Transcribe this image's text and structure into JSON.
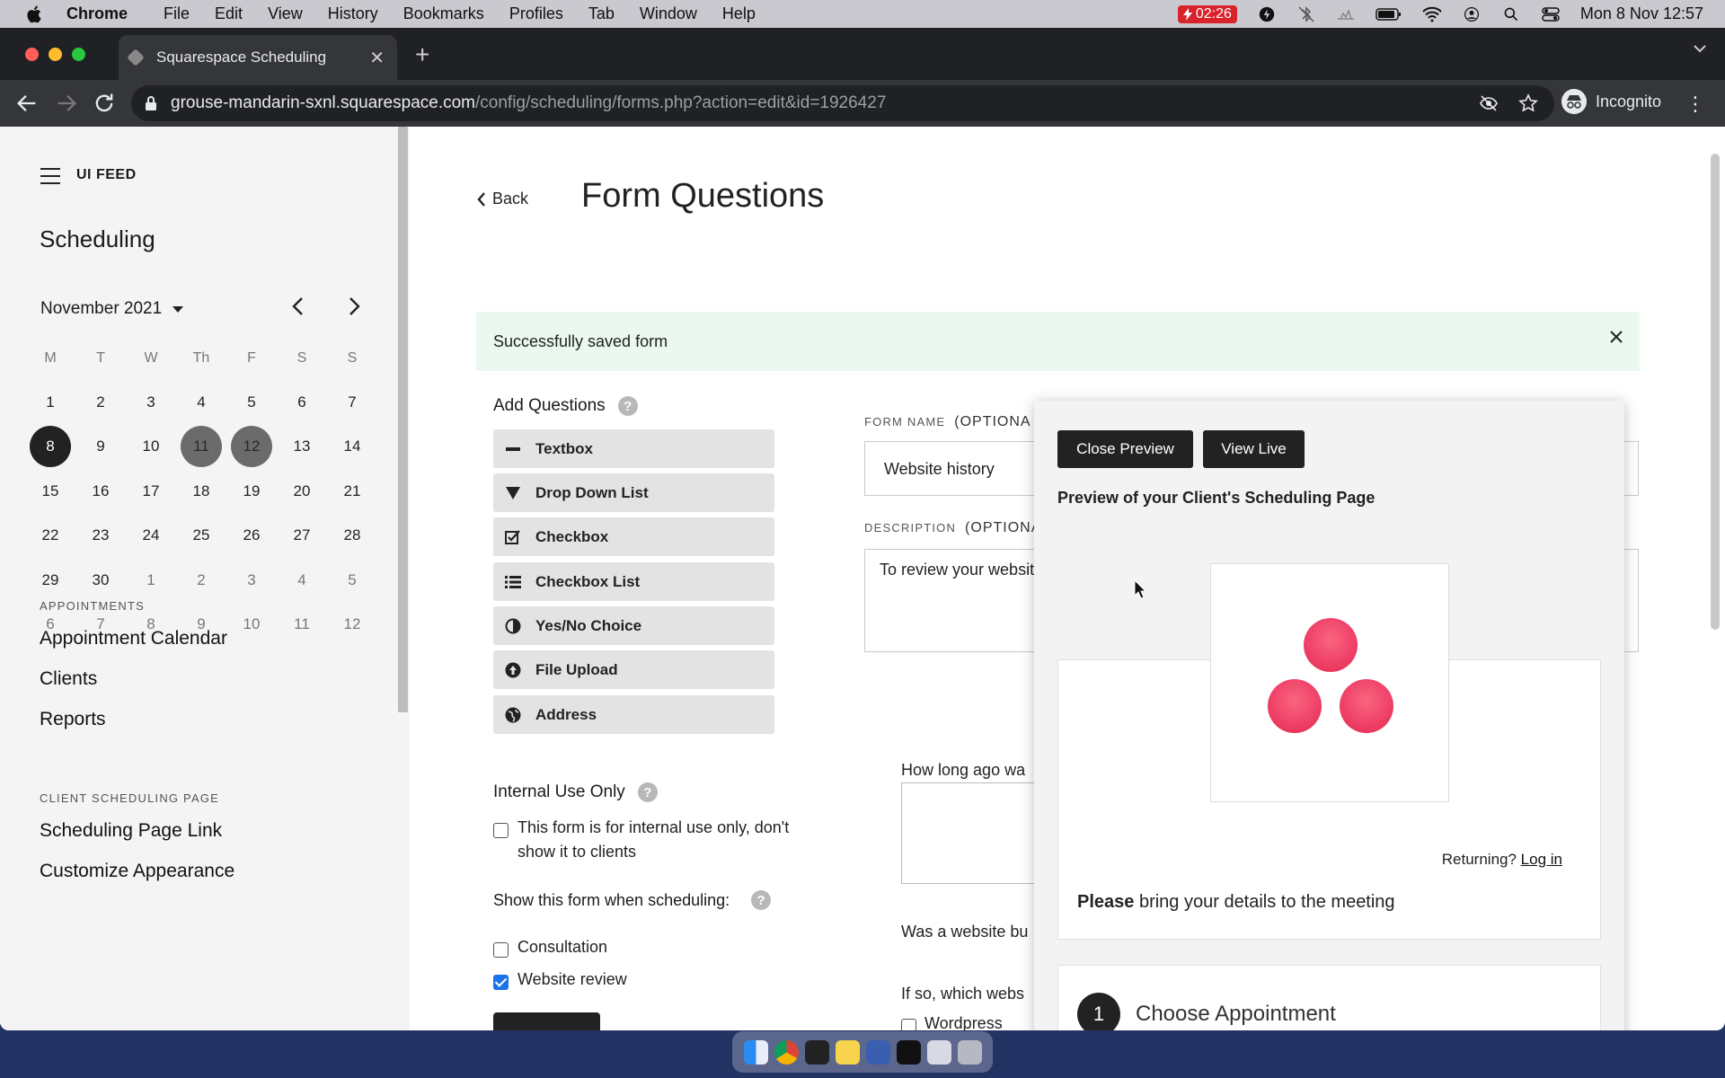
{
  "menubar": {
    "app": "Chrome",
    "items": [
      "File",
      "Edit",
      "View",
      "History",
      "Bookmarks",
      "Profiles",
      "Tab",
      "Window",
      "Help"
    ],
    "battery_time": "02:26",
    "datetime": "Mon 8 Nov  12:57"
  },
  "browser": {
    "tab_title": "Squarespace Scheduling",
    "url_host": "grouse-mandarin-sxnl.squarespace.com",
    "url_path": "/config/scheduling/forms.php?action=edit&id=1926427",
    "profile": "Incognito"
  },
  "sidebar": {
    "brand": "UI FEED",
    "title": "Scheduling",
    "month": "November 2021",
    "weekdays": [
      "M",
      "T",
      "W",
      "Th",
      "F",
      "S",
      "S"
    ],
    "weeks": [
      [
        "1",
        "2",
        "3",
        "4",
        "5",
        "6",
        "7"
      ],
      [
        "8",
        "9",
        "10",
        "11",
        "12",
        "13",
        "14"
      ],
      [
        "15",
        "16",
        "17",
        "18",
        "19",
        "20",
        "21"
      ],
      [
        "22",
        "23",
        "24",
        "25",
        "26",
        "27",
        "28"
      ],
      [
        "29",
        "30",
        "1",
        "2",
        "3",
        "4",
        "5"
      ],
      [
        "6",
        "7",
        "8",
        "9",
        "10",
        "11",
        "12"
      ]
    ],
    "appointments_label": "APPOINTMENTS",
    "appointments_links": [
      "Appointment Calendar",
      "Clients",
      "Reports"
    ],
    "client_label": "CLIENT SCHEDULING PAGE",
    "client_links": [
      "Scheduling Page Link",
      "Customize Appearance"
    ]
  },
  "main": {
    "back": "Back",
    "title": "Form Questions",
    "toast": "Successfully saved form",
    "add_questions": "Add Questions",
    "question_types": [
      "Textbox",
      "Drop Down List",
      "Checkbox",
      "Checkbox List",
      "Yes/No Choice",
      "File Upload",
      "Address"
    ],
    "form_name_label": "FORM NAME",
    "form_name_opt": "(OPTIONA",
    "form_name_value": "Website history",
    "description_label": "DESCRIPTION",
    "description_opt": "(OPTIONA",
    "description_value": "To review your websit",
    "internal_label": "Internal Use Only",
    "internal_checkbox_line1": "This form is for internal use only, don't",
    "internal_checkbox_line2": "show it to clients",
    "show_when": "Show this form when scheduling:",
    "appointment_types": [
      "Consultation",
      "Website review"
    ],
    "q1": "How long ago wa",
    "q2": "Was a website bu",
    "q3": "If so, which webs",
    "q3_option1": "Wordpress"
  },
  "preview": {
    "close_btn": "Close Preview",
    "view_live_btn": "View Live",
    "heading": "Preview of your Client's Scheduling Page",
    "returning": "Returning?",
    "login": "Log in",
    "please_bold": "Please",
    "please_rest": " bring your details to the meeting",
    "step_num": "1",
    "step_title": "Choose Appointment"
  },
  "colors": {
    "accent_logo": "#f0436a",
    "toast_bg": "#eaf8ef",
    "checkbox_blue": "#1a73e8"
  }
}
